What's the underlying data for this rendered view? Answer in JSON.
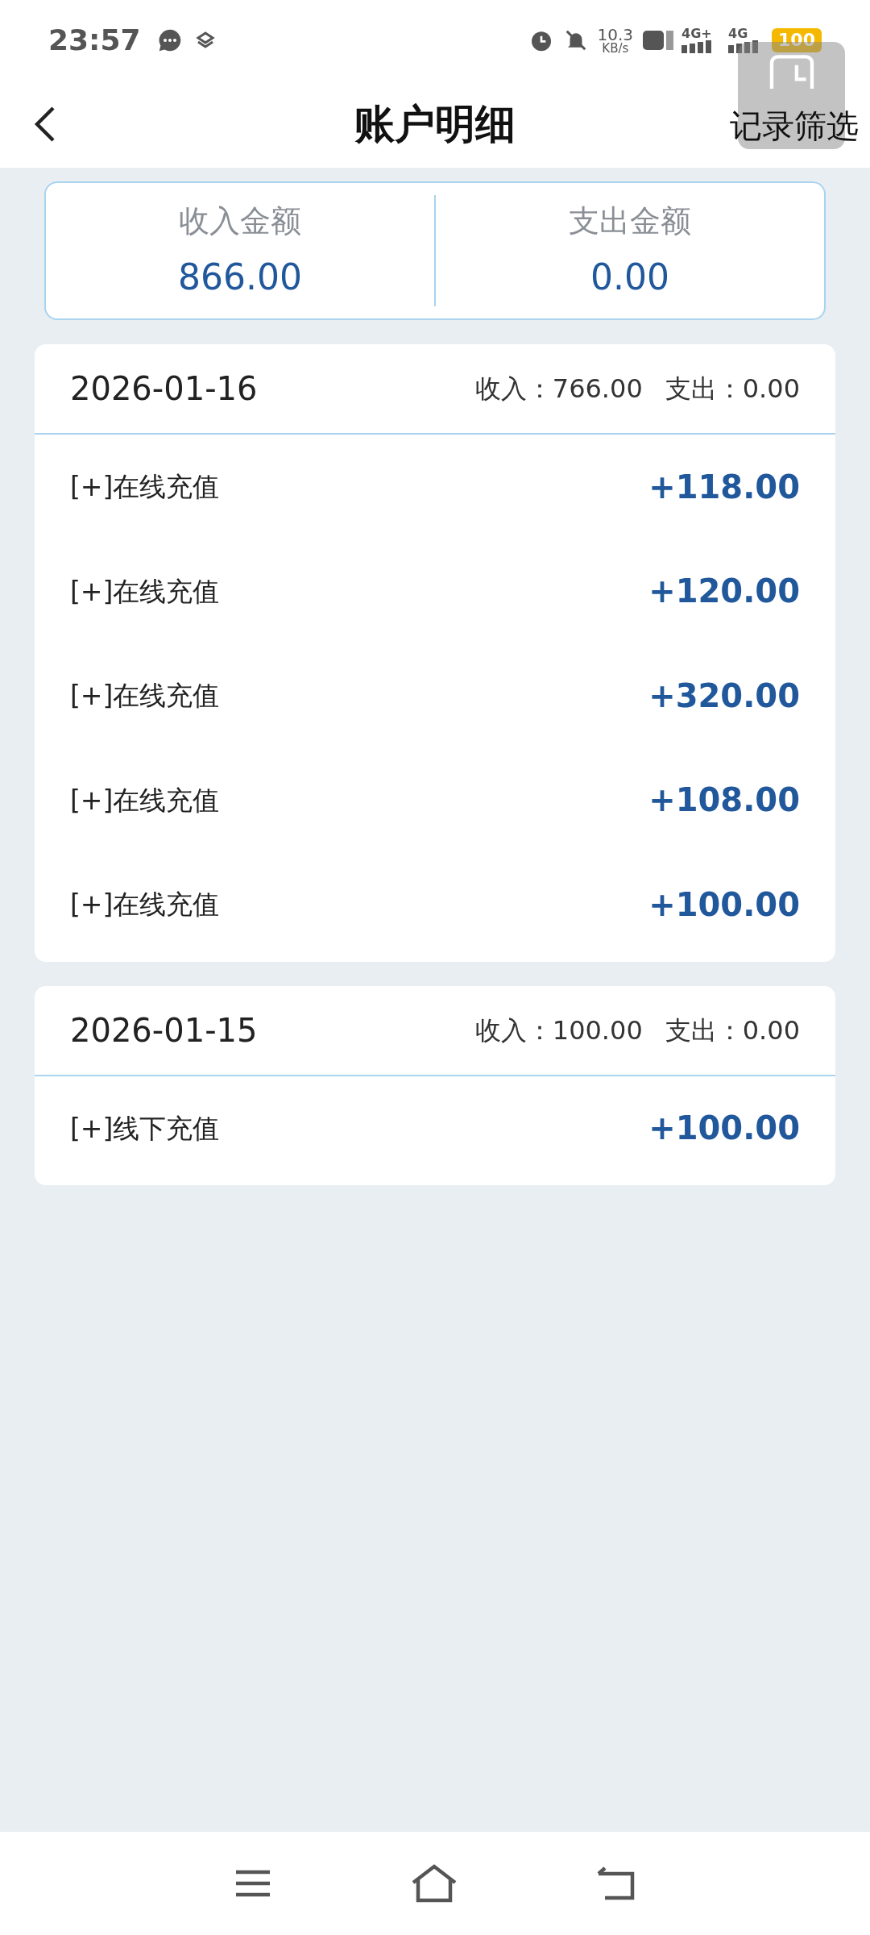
{
  "status_bar": {
    "time": "23:57",
    "speed": "10.3",
    "speed_unit": "KB/s",
    "sim_1": "4G+",
    "sim_2": "4G",
    "battery": "100"
  },
  "header": {
    "title": "账户明细",
    "action": "记录筛选"
  },
  "summary": [
    {
      "label": "收入金额",
      "value": "866.00"
    },
    {
      "label": "支出金额",
      "value": "0.00"
    }
  ],
  "groups": [
    {
      "date": "2026-01-16",
      "income": "收入：766.00",
      "expense": "支出：0.00",
      "items": [
        {
          "label": "[+]在线充值",
          "amount": "+118.00"
        },
        {
          "label": "[+]在线充值",
          "amount": "+120.00"
        },
        {
          "label": "[+]在线充值",
          "amount": "+320.00"
        },
        {
          "label": "[+]在线充值",
          "amount": "+108.00"
        },
        {
          "label": "[+]在线充值",
          "amount": "+100.00"
        }
      ]
    },
    {
      "date": "2026-01-15",
      "income": "收入：100.00",
      "expense": "支出：0.00",
      "items": [
        {
          "label": "[+]线下充值",
          "amount": "+100.00"
        }
      ]
    }
  ]
}
